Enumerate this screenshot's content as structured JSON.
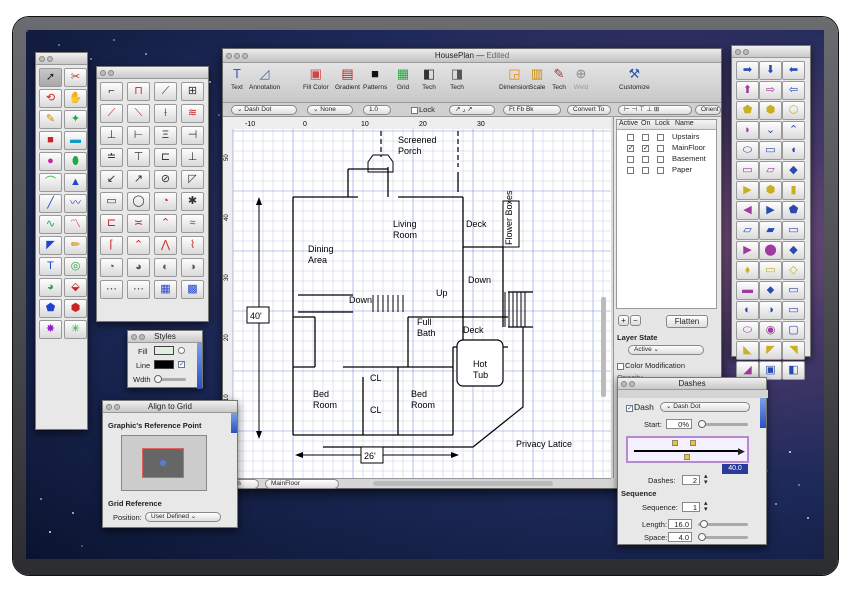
{
  "window": {
    "title": "HousePlan",
    "status": "Edited"
  },
  "toolbar": {
    "items": [
      {
        "label": "Text",
        "icon": "T"
      },
      {
        "label": "Annotation",
        "icon": "◿"
      },
      {
        "label": "Fill Color",
        "icon": "▣"
      },
      {
        "label": "Gradient",
        "icon": "▤"
      },
      {
        "label": "Patterns",
        "icon": "■"
      },
      {
        "label": "Grid",
        "icon": "▦"
      },
      {
        "label": "Tech",
        "icon": "◧"
      },
      {
        "label": "Tech",
        "icon": "◨"
      },
      {
        "label": "Dimension",
        "icon": "◲"
      },
      {
        "label": "Scale",
        "icon": "▥"
      },
      {
        "label": "Tech",
        "icon": "✎"
      },
      {
        "label": "Weld",
        "icon": "⊕"
      },
      {
        "label": "Customize",
        "icon": "⚒"
      }
    ]
  },
  "stylebar": {
    "line_style": "Dash Dot",
    "arrow": "None",
    "weight": "1.0",
    "lock": "Lock",
    "align": "Convert To",
    "orient": "Orient"
  },
  "ruler": {
    "labels": [
      "-10",
      "0",
      "10",
      "20",
      "30"
    ],
    "vlabels": [
      "50",
      "40",
      "30",
      "20",
      "10"
    ]
  },
  "plan": {
    "labels": [
      "Screened\nPorch",
      "Living\nRoom",
      "Deck",
      "Dining\nArea",
      "Flower Boxes",
      "Down",
      "Up",
      "Down",
      "Full\nBath",
      "Deck",
      "Hot\nTub",
      "Bed\nRoom",
      "CL",
      "CL",
      "Bed\nRoom",
      "Privacy Latice"
    ],
    "dim_vertical": "40'",
    "dim_horizontal": "26'"
  },
  "bottom": {
    "zoom": "%",
    "layer": "MainFloor"
  },
  "layers": {
    "headers": [
      "Active",
      "On",
      "Lock",
      "Name"
    ],
    "rows": [
      {
        "name": "Upstairs",
        "active": false,
        "on": false,
        "lock": false
      },
      {
        "name": "MainFloor",
        "active": true,
        "on": true,
        "lock": false
      },
      {
        "name": "Basement",
        "active": false,
        "on": false,
        "lock": false
      },
      {
        "name": "Paper",
        "active": false,
        "on": false,
        "lock": false
      }
    ],
    "flatten": "Flatten",
    "state_label": "Layer State",
    "state_value": "Active",
    "color_mod": "Color Modification",
    "opacity": "Opacity"
  },
  "styles_panel": {
    "title": "Styles",
    "fill": "Fill",
    "line": "Line",
    "width": "Wdth"
  },
  "align_panel": {
    "title": "Align to Grid",
    "ref_point": "Graphic's Reference Point",
    "grid_ref": "Grid Reference",
    "position_label": "Position:",
    "position_value": "User Defined"
  },
  "dashes_panel": {
    "title": "Dashes",
    "dash_label": "Dash",
    "dash_value": "Dash Dot",
    "start_label": "Start:",
    "start_value": "0%",
    "dashes_label": "Dashes:",
    "dashes_value": "2",
    "readout": "40.0",
    "sequence": "Sequence",
    "seq_label": "Sequence:",
    "seq_value": "1",
    "length_label": "Length:",
    "length_value": "16.0",
    "space_label": "Space:",
    "space_value": "4.0"
  },
  "colors": {
    "accent": "#3a5fc8",
    "grid_minor": "#c8d0e4",
    "grid_major": "#7f90d8",
    "dash_track": "#b48ad0"
  }
}
